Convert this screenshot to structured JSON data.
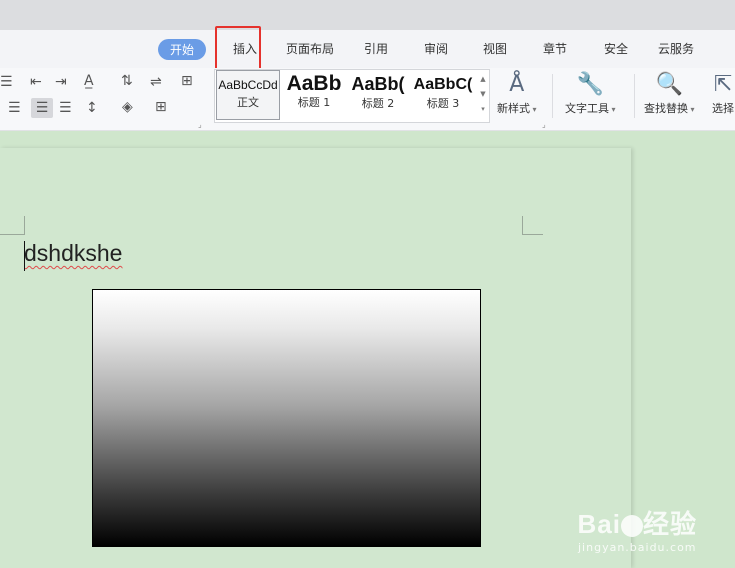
{
  "tabs": [
    {
      "label": "开始",
      "active": true
    },
    {
      "label": "插入",
      "highlighted": true
    },
    {
      "label": "页面布局"
    },
    {
      "label": "引用"
    },
    {
      "label": "审阅"
    },
    {
      "label": "视图"
    },
    {
      "label": "章节"
    },
    {
      "label": "安全"
    },
    {
      "label": "云服务"
    }
  ],
  "ribbon": {
    "styles": [
      {
        "sample": "AaBbCcDd",
        "name": "正文"
      },
      {
        "sample": "AaBb",
        "name": "标题 1"
      },
      {
        "sample": "AaBb(",
        "name": "标题 2"
      },
      {
        "sample": "AaBbC(",
        "name": "标题 3"
      }
    ],
    "new_style_label": "新样式",
    "text_tools_label": "文字工具",
    "find_replace_label": "查找替换",
    "select_label": "选择"
  },
  "document": {
    "text": "dshdkshe"
  },
  "watermark": {
    "brand_left": "Bai",
    "brand_right": "经验",
    "url": "jingyan.baidu.com"
  },
  "colors": {
    "active_tab": "#6a9ce6",
    "highlight_box": "#e5322d",
    "page_background": "#d1e7cf"
  }
}
